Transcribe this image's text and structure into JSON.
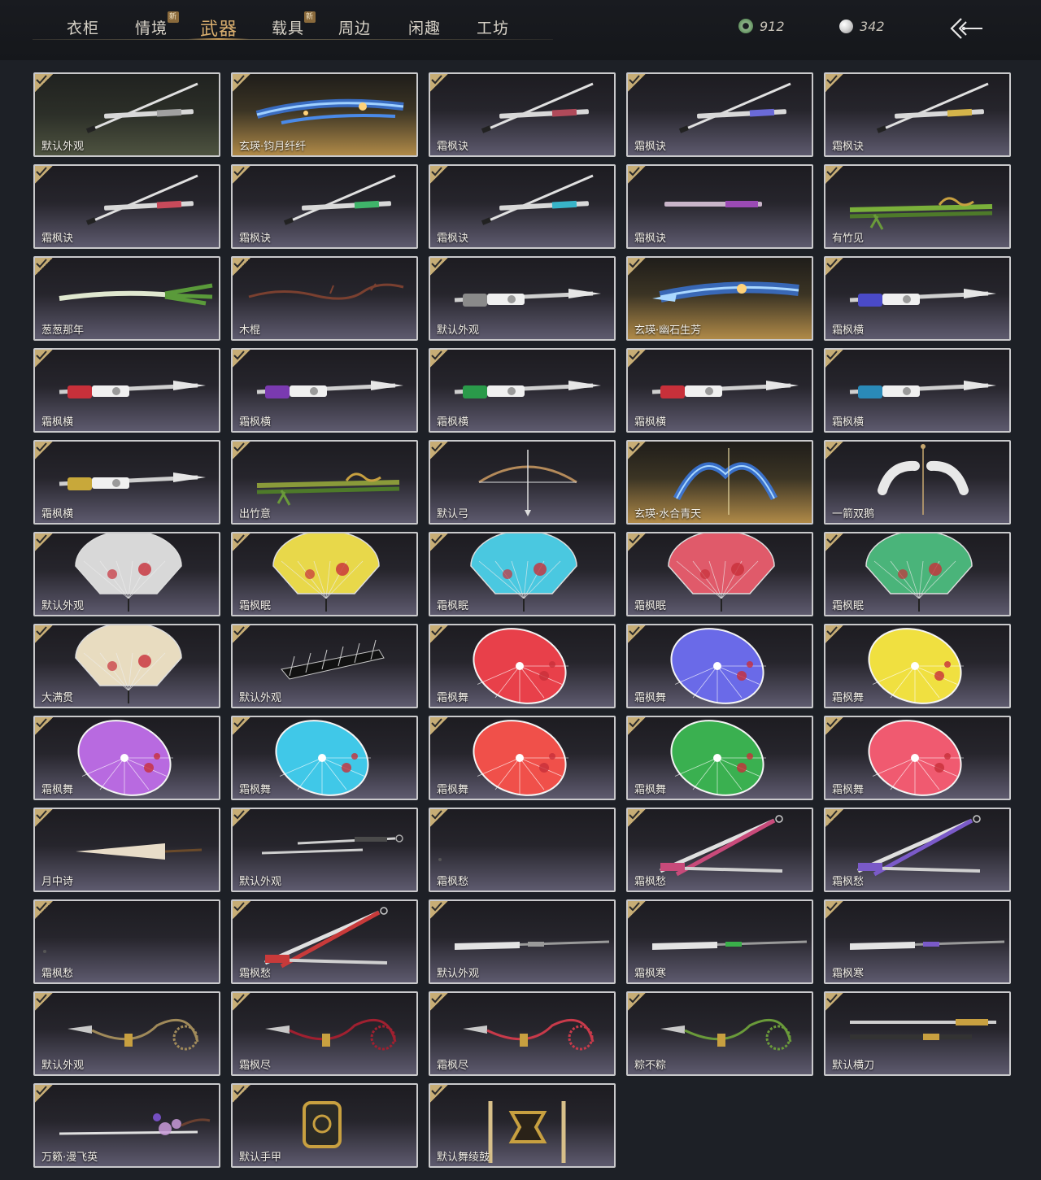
{
  "tabs": [
    {
      "label": "衣柜",
      "active": false,
      "new": false
    },
    {
      "label": "情境",
      "active": false,
      "new": true
    },
    {
      "label": "武器",
      "active": true,
      "new": false
    },
    {
      "label": "载具",
      "active": false,
      "new": true
    },
    {
      "label": "周边",
      "active": false,
      "new": false
    },
    {
      "label": "闲趣",
      "active": false,
      "new": false
    },
    {
      "label": "工坊",
      "active": false,
      "new": false
    }
  ],
  "new_badge": "新",
  "currency": {
    "jade": "912",
    "pearl": "342"
  },
  "items": [
    {
      "name": "默认外观",
      "icon": "sword",
      "style": "olive",
      "color": "#a0a0a0"
    },
    {
      "name": "玄瑛·钧月纤纤",
      "icon": "sword-glow",
      "style": "gold",
      "color": "#3a7be8"
    },
    {
      "name": "霜枫诀",
      "icon": "sword",
      "style": "",
      "color": "#b04a5a"
    },
    {
      "name": "霜枫诀",
      "icon": "sword",
      "style": "",
      "color": "#6a6ad8"
    },
    {
      "name": "霜枫诀",
      "icon": "sword",
      "style": "",
      "color": "#d4b44a"
    },
    {
      "name": "霜枫诀",
      "icon": "sword",
      "style": "",
      "color": "#c84a5a"
    },
    {
      "name": "霜枫诀",
      "icon": "sword",
      "style": "",
      "color": "#3fb46a"
    },
    {
      "name": "霜枫诀",
      "icon": "sword",
      "style": "",
      "color": "#38b4c8"
    },
    {
      "name": "霜枫诀",
      "icon": "sword-short",
      "style": "",
      "color": "#9a4ab4"
    },
    {
      "name": "有竹见",
      "icon": "bamboo",
      "style": "",
      "color": "#7ab03a"
    },
    {
      "name": "葱葱那年",
      "icon": "leek",
      "style": "",
      "color": "#5a9a3a"
    },
    {
      "name": "木棍",
      "icon": "stick",
      "style": "",
      "color": "#7a4030"
    },
    {
      "name": "默认外观",
      "icon": "spear",
      "style": "",
      "color": "#8a8a8a"
    },
    {
      "name": "玄瑛·幽石生芳",
      "icon": "spear-glow",
      "style": "gold",
      "color": "#3a7be8"
    },
    {
      "name": "霜枫横",
      "icon": "spear",
      "style": "",
      "color": "#4a4ac8"
    },
    {
      "name": "霜枫横",
      "icon": "spear",
      "style": "",
      "color": "#c8303a"
    },
    {
      "name": "霜枫横",
      "icon": "spear",
      "style": "",
      "color": "#7a3ab0"
    },
    {
      "name": "霜枫横",
      "icon": "spear",
      "style": "",
      "color": "#2a9a4a"
    },
    {
      "name": "霜枫横",
      "icon": "spear",
      "style": "",
      "color": "#c8303a"
    },
    {
      "name": "霜枫横",
      "icon": "spear",
      "style": "",
      "color": "#2a8ab8"
    },
    {
      "name": "霜枫横",
      "icon": "spear",
      "style": "",
      "color": "#c8a83a"
    },
    {
      "name": "出竹意",
      "icon": "bamboo",
      "style": "",
      "color": "#8a9a3a"
    },
    {
      "name": "默认弓",
      "icon": "bow",
      "style": "",
      "color": "#b48a5a"
    },
    {
      "name": "玄瑛·水合青天",
      "icon": "bow-glow",
      "style": "gold",
      "color": "#3a7be8"
    },
    {
      "name": "一箭双鹅",
      "icon": "bow-goose",
      "style": "",
      "color": "#e8e8e8"
    },
    {
      "name": "默认外观",
      "icon": "fan",
      "style": "",
      "color": "#d8d8d8"
    },
    {
      "name": "霜枫眠",
      "icon": "fan",
      "style": "",
      "color": "#e8d84a"
    },
    {
      "name": "霜枫眠",
      "icon": "fan",
      "style": "",
      "color": "#4ac8e0"
    },
    {
      "name": "霜枫眠",
      "icon": "fan",
      "style": "",
      "color": "#e05a6a"
    },
    {
      "name": "霜枫眠",
      "icon": "fan",
      "style": "",
      "color": "#4ab47a"
    },
    {
      "name": "大满贯",
      "icon": "fan",
      "style": "",
      "color": "#e8dcc0"
    },
    {
      "name": "默认外观",
      "icon": "fan-closed",
      "style": "",
      "color": "#c8c8c8"
    },
    {
      "name": "霜枫舞",
      "icon": "umbrella",
      "style": "",
      "color": "#e8404a"
    },
    {
      "name": "霜枫舞",
      "icon": "umbrella",
      "style": "",
      "color": "#6a6ae8"
    },
    {
      "name": "霜枫舞",
      "icon": "umbrella",
      "style": "",
      "color": "#f0e040"
    },
    {
      "name": "霜枫舞",
      "icon": "umbrella",
      "style": "",
      "color": "#b86ae0"
    },
    {
      "name": "霜枫舞",
      "icon": "umbrella",
      "style": "",
      "color": "#40c8e8"
    },
    {
      "name": "霜枫舞",
      "icon": "umbrella",
      "style": "",
      "color": "#f0504a"
    },
    {
      "name": "霜枫舞",
      "icon": "umbrella",
      "style": "",
      "color": "#3ab050"
    },
    {
      "name": "霜枫舞",
      "icon": "umbrella",
      "style": "",
      "color": "#f05a70"
    },
    {
      "name": "月中诗",
      "icon": "umbrella-closed",
      "style": "",
      "color": "#e8dcc8"
    },
    {
      "name": "默认外观",
      "icon": "dual-blades",
      "style": "",
      "color": "#9a9a9a"
    },
    {
      "name": "霜枫愁",
      "icon": "dot",
      "style": "",
      "color": "#555555"
    },
    {
      "name": "霜枫愁",
      "icon": "cross-blades",
      "style": "",
      "color": "#c84a7a"
    },
    {
      "name": "霜枫愁",
      "icon": "cross-blades",
      "style": "",
      "color": "#7a5ac8"
    },
    {
      "name": "霜枫愁",
      "icon": "dot",
      "style": "",
      "color": "#555555"
    },
    {
      "name": "霜枫愁",
      "icon": "cross-blades",
      "style": "",
      "color": "#c83a3a"
    },
    {
      "name": "默认外观",
      "icon": "glaive",
      "style": "",
      "color": "#9a9a9a"
    },
    {
      "name": "霜枫寒",
      "icon": "glaive",
      "style": "",
      "color": "#3ab04a"
    },
    {
      "name": "霜枫寒",
      "icon": "glaive",
      "style": "",
      "color": "#7a5ac8"
    },
    {
      "name": "默认外观",
      "icon": "rope-dart",
      "style": "",
      "color": "#a08a5a"
    },
    {
      "name": "霜枫尽",
      "icon": "rope-dart",
      "style": "",
      "color": "#a02030"
    },
    {
      "name": "霜枫尽",
      "icon": "rope-dart",
      "style": "",
      "color": "#c83a4a"
    },
    {
      "name": "粽不粽",
      "icon": "rope-dart",
      "style": "",
      "color": "#6a9a3a"
    },
    {
      "name": "默认横刀",
      "icon": "saber",
      "style": "",
      "color": "#c8a040"
    },
    {
      "name": "万籁·漫飞英",
      "icon": "sword-blossom",
      "style": "",
      "color": "#c89ad8"
    },
    {
      "name": "默认手甲",
      "icon": "gauntlet",
      "style": "",
      "color": "#c8a040"
    },
    {
      "name": "默认舞绫鼓",
      "icon": "drum",
      "style": "",
      "color": "#c8a040"
    }
  ]
}
